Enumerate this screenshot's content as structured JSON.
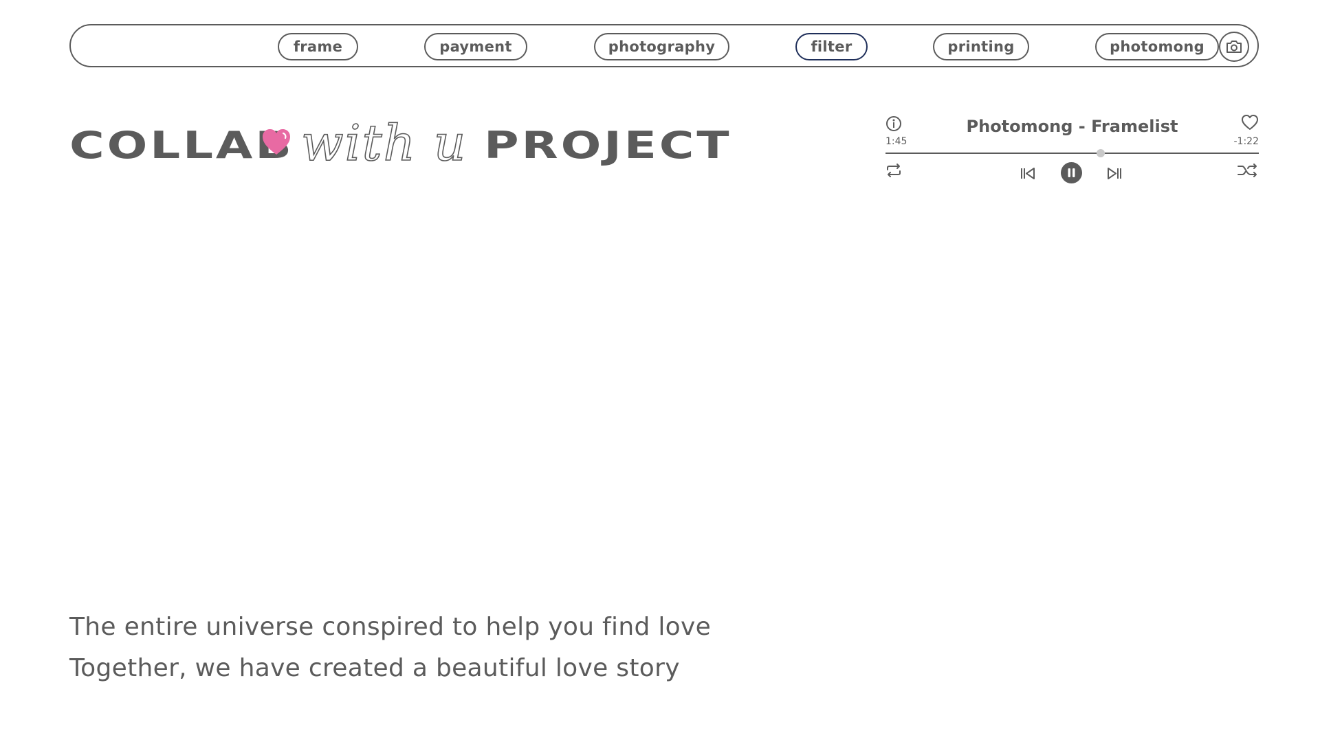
{
  "nav": {
    "items": [
      {
        "label": "frame"
      },
      {
        "label": "payment"
      },
      {
        "label": "photography"
      },
      {
        "label": "filter",
        "active": true
      },
      {
        "label": "printing"
      },
      {
        "label": "photomong"
      }
    ],
    "camera_icon": "camera-icon"
  },
  "headline": {
    "word1": "COLLAB",
    "heart_icon": "heart-icon",
    "script": "with u",
    "word2": "PROJECT",
    "heart_color": "#e86aa3"
  },
  "player": {
    "title": "Photomong - Framelist",
    "elapsed": "1:45",
    "remaining": "-1:22",
    "progress": 0.576,
    "icons": {
      "info": "info-icon",
      "like": "heart-outline-icon",
      "repeat": "repeat-icon",
      "previous": "skip-previous-icon",
      "pause": "pause-icon",
      "next": "skip-next-icon",
      "shuffle": "shuffle-icon"
    }
  },
  "body_text": {
    "line1": "The entire universe conspired to help you find love",
    "line2": "Together, we have created a beautiful love story"
  },
  "colors": {
    "text": "#5b5b5b",
    "active_border": "#1f2f5a",
    "knob": "#c9c9c9"
  }
}
